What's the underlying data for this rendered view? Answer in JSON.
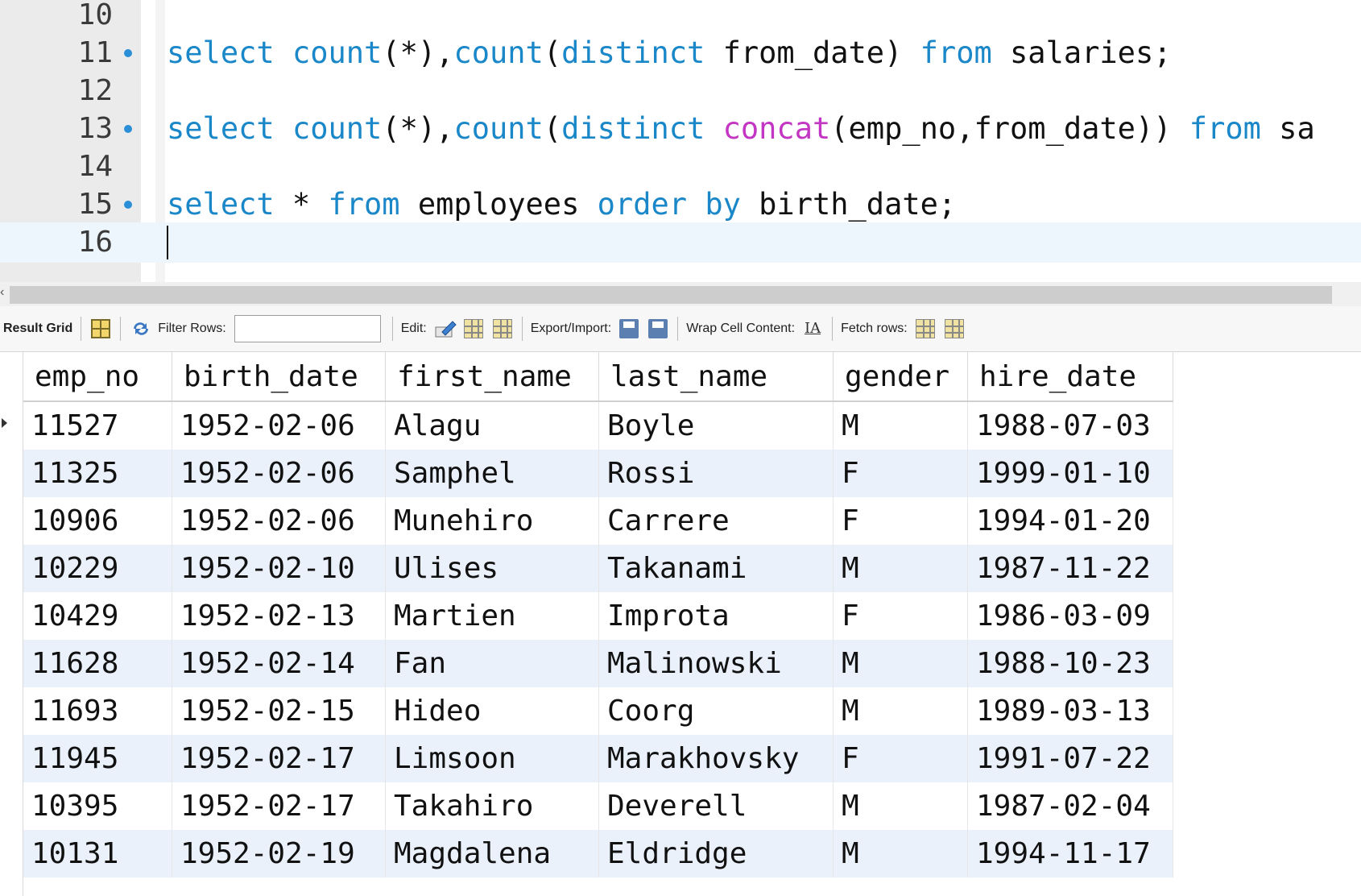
{
  "editor": {
    "lines": [
      {
        "num": "10",
        "dot": false,
        "tokens": []
      },
      {
        "num": "11",
        "dot": true,
        "tokens": [
          {
            "t": "select",
            "c": "kw"
          },
          {
            "t": " ",
            "c": "id"
          },
          {
            "t": "count",
            "c": "kw"
          },
          {
            "t": "(*),",
            "c": "id"
          },
          {
            "t": "count",
            "c": "kw"
          },
          {
            "t": "(",
            "c": "id"
          },
          {
            "t": "distinct",
            "c": "kw"
          },
          {
            "t": " from_date) ",
            "c": "id"
          },
          {
            "t": "from",
            "c": "kw"
          },
          {
            "t": " salaries;",
            "c": "id"
          }
        ]
      },
      {
        "num": "12",
        "dot": false,
        "tokens": []
      },
      {
        "num": "13",
        "dot": true,
        "tokens": [
          {
            "t": "select",
            "c": "kw"
          },
          {
            "t": " ",
            "c": "id"
          },
          {
            "t": "count",
            "c": "kw"
          },
          {
            "t": "(*),",
            "c": "id"
          },
          {
            "t": "count",
            "c": "kw"
          },
          {
            "t": "(",
            "c": "id"
          },
          {
            "t": "distinct",
            "c": "kw"
          },
          {
            "t": " ",
            "c": "id"
          },
          {
            "t": "concat",
            "c": "fn"
          },
          {
            "t": "(emp_no,from_date)) ",
            "c": "id"
          },
          {
            "t": "from",
            "c": "kw"
          },
          {
            "t": " sa",
            "c": "id"
          }
        ]
      },
      {
        "num": "14",
        "dot": false,
        "tokens": []
      },
      {
        "num": "15",
        "dot": true,
        "tokens": [
          {
            "t": "select",
            "c": "kw"
          },
          {
            "t": " * ",
            "c": "id"
          },
          {
            "t": "from",
            "c": "kw"
          },
          {
            "t": " employees ",
            "c": "id"
          },
          {
            "t": "order",
            "c": "kw"
          },
          {
            "t": " ",
            "c": "id"
          },
          {
            "t": "by",
            "c": "kw"
          },
          {
            "t": " birth_date;",
            "c": "id"
          }
        ]
      },
      {
        "num": "16",
        "dot": false,
        "tokens": [],
        "current": true
      }
    ]
  },
  "toolbar": {
    "result_grid_label": "Result Grid",
    "filter_rows_label": "Filter Rows:",
    "filter_rows_value": "",
    "edit_label": "Edit:",
    "export_import_label": "Export/Import:",
    "wrap_cell_label": "Wrap Cell Content:",
    "fetch_rows_label": "Fetch rows:"
  },
  "grid": {
    "columns": [
      "emp_no",
      "birth_date",
      "first_name",
      "last_name",
      "gender",
      "hire_date"
    ],
    "rows": [
      [
        "11527",
        "1952-02-06",
        "Alagu",
        "Boyle",
        "M",
        "1988-07-03"
      ],
      [
        "11325",
        "1952-02-06",
        "Samphel",
        "Rossi",
        "F",
        "1999-01-10"
      ],
      [
        "10906",
        "1952-02-06",
        "Munehiro",
        "Carrere",
        "F",
        "1994-01-20"
      ],
      [
        "10229",
        "1952-02-10",
        "Ulises",
        "Takanami",
        "M",
        "1987-11-22"
      ],
      [
        "10429",
        "1952-02-13",
        "Martien",
        "Improta",
        "F",
        "1986-03-09"
      ],
      [
        "11628",
        "1952-02-14",
        "Fan",
        "Malinowski",
        "M",
        "1988-10-23"
      ],
      [
        "11693",
        "1952-02-15",
        "Hideo",
        "Coorg",
        "M",
        "1989-03-13"
      ],
      [
        "11945",
        "1952-02-17",
        "Limsoon",
        "Marakhovsky",
        "F",
        "1991-07-22"
      ],
      [
        "10395",
        "1952-02-17",
        "Takahiro",
        "Deverell",
        "M",
        "1987-02-04"
      ],
      [
        "10131",
        "1952-02-19",
        "Magdalena",
        "Eldridge",
        "M",
        "1994-11-17"
      ]
    ]
  },
  "colors": {
    "keyword": "#1a87c9",
    "function": "#c335c3",
    "exec_dot": "#2a8fd6",
    "row_alt": "#eaf1fb"
  }
}
